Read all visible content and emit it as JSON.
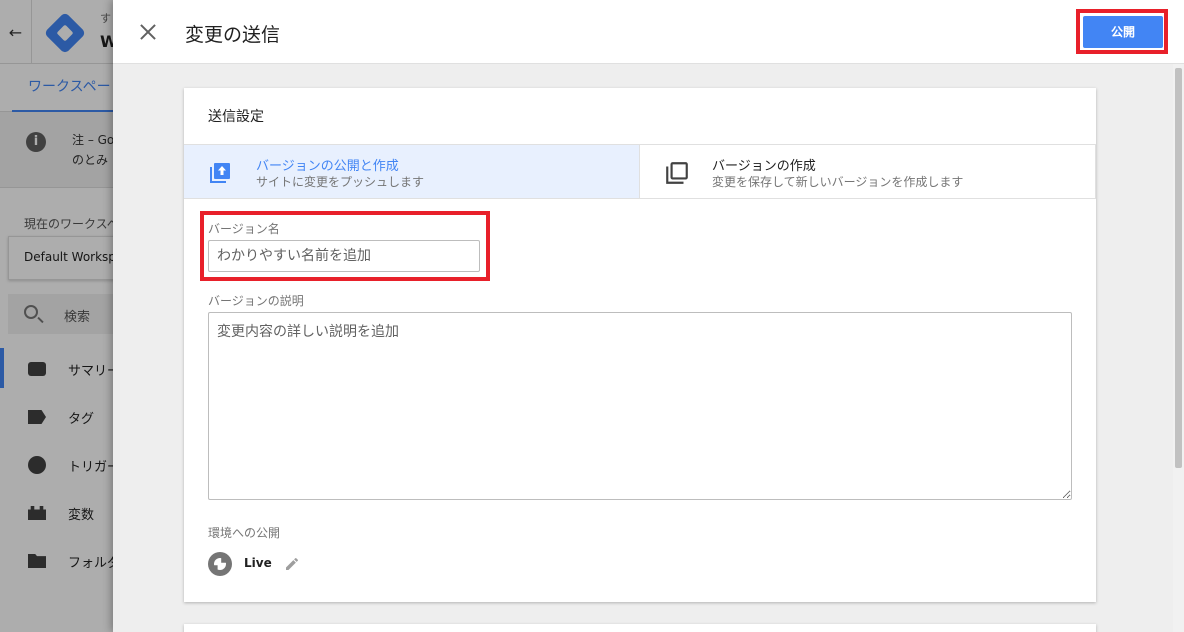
{
  "background": {
    "account_label": "す",
    "container_name": "W",
    "workspace_tab": "ワークスペー",
    "notice_lines": [
      "注 – Go",
      "のとみ"
    ],
    "current_workspace_label": "現在のワークスペ",
    "workspace_name": "Default Worksp",
    "search_label": "検索",
    "nav": [
      "サマリー",
      "タグ",
      "トリガー",
      "変数",
      "フォルダ"
    ]
  },
  "panel": {
    "title": "変更の送信",
    "publish_label": "公開"
  },
  "card": {
    "title": "送信設定",
    "options": [
      {
        "title": "バージョンの公開と作成",
        "subtitle": "サイトに変更をプッシュします",
        "selected": true
      },
      {
        "title": "バージョンの作成",
        "subtitle": "変更を保存して新しいバージョンを作成します",
        "selected": false
      }
    ],
    "version_name_label": "バージョン名",
    "version_name_placeholder": "わかりやすい名前を追加",
    "version_desc_label": "バージョンの説明",
    "version_desc_placeholder": "変更内容の詳しい説明を追加",
    "environment_label": "環境への公開",
    "environment_name": "Live"
  },
  "colors": {
    "accent": "#4285f4",
    "highlight": "#e8202a",
    "selected_option_bg": "#e8f0fe"
  }
}
